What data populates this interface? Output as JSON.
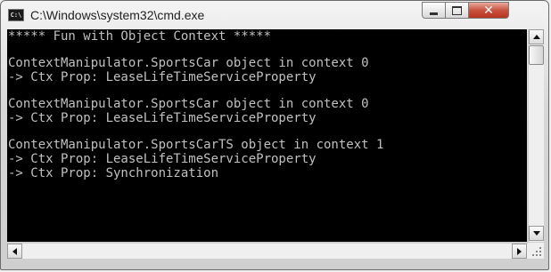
{
  "window": {
    "title": "C:\\Windows\\system32\\cmd.exe",
    "icon_label": "C:\\",
    "controls": [
      "minimize-icon",
      "maximize-icon",
      "close-icon"
    ],
    "close_glyph": "✕"
  },
  "console": {
    "lines": [
      "***** Fun with Object Context *****",
      "",
      "ContextManipulator.SportsCar object in context 0",
      "-> Ctx Prop: LeaseLifeTimeServiceProperty",
      "",
      "ContextManipulator.SportsCar object in context 0",
      "-> Ctx Prop: LeaseLifeTimeServiceProperty",
      "",
      "ContextManipulator.SportsCarTS object in context 1",
      "-> Ctx Prop: LeaseLifeTimeServiceProperty",
      "-> Ctx Prop: Synchronization"
    ],
    "colors": {
      "background": "#000000",
      "text": "#c0c0c0"
    }
  }
}
